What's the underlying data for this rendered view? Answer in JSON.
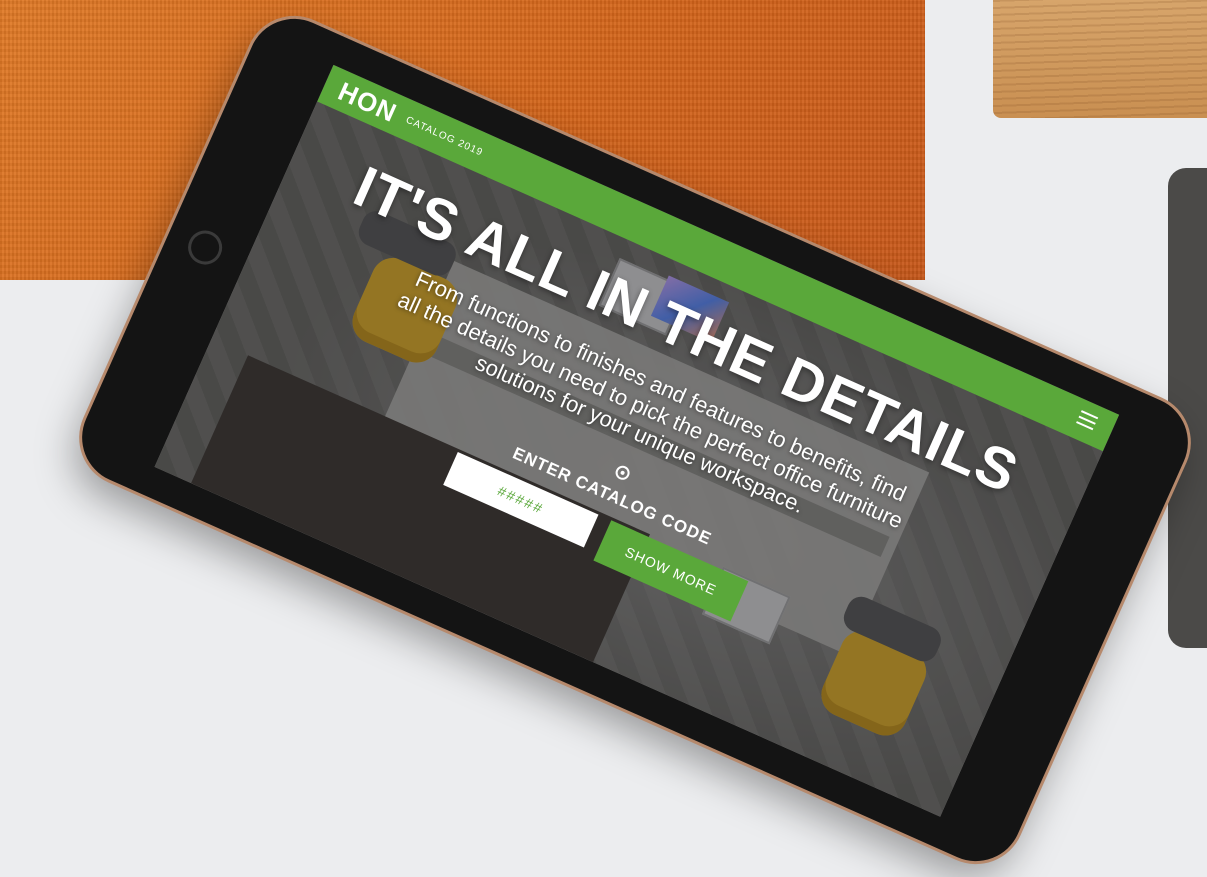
{
  "header": {
    "logo": "HON",
    "catalog_tag": "CATALOG 2019"
  },
  "hero": {
    "headline": "IT'S ALL IN THE DETAILS",
    "subtitle": "From functions to finishes and features to benefits, find all the details you need to pick the perfect office furniture solutions for your unique workspace."
  },
  "catalog_code": {
    "label": "ENTER CATALOG CODE",
    "placeholder": "#####",
    "button_label": "SHOW MORE"
  },
  "icons": {
    "menu": "hamburger-menu-icon",
    "signal": "nfc-signal-icon"
  },
  "colors": {
    "accent_green": "#5aa83a",
    "fabric_orange": "#d4651a"
  }
}
